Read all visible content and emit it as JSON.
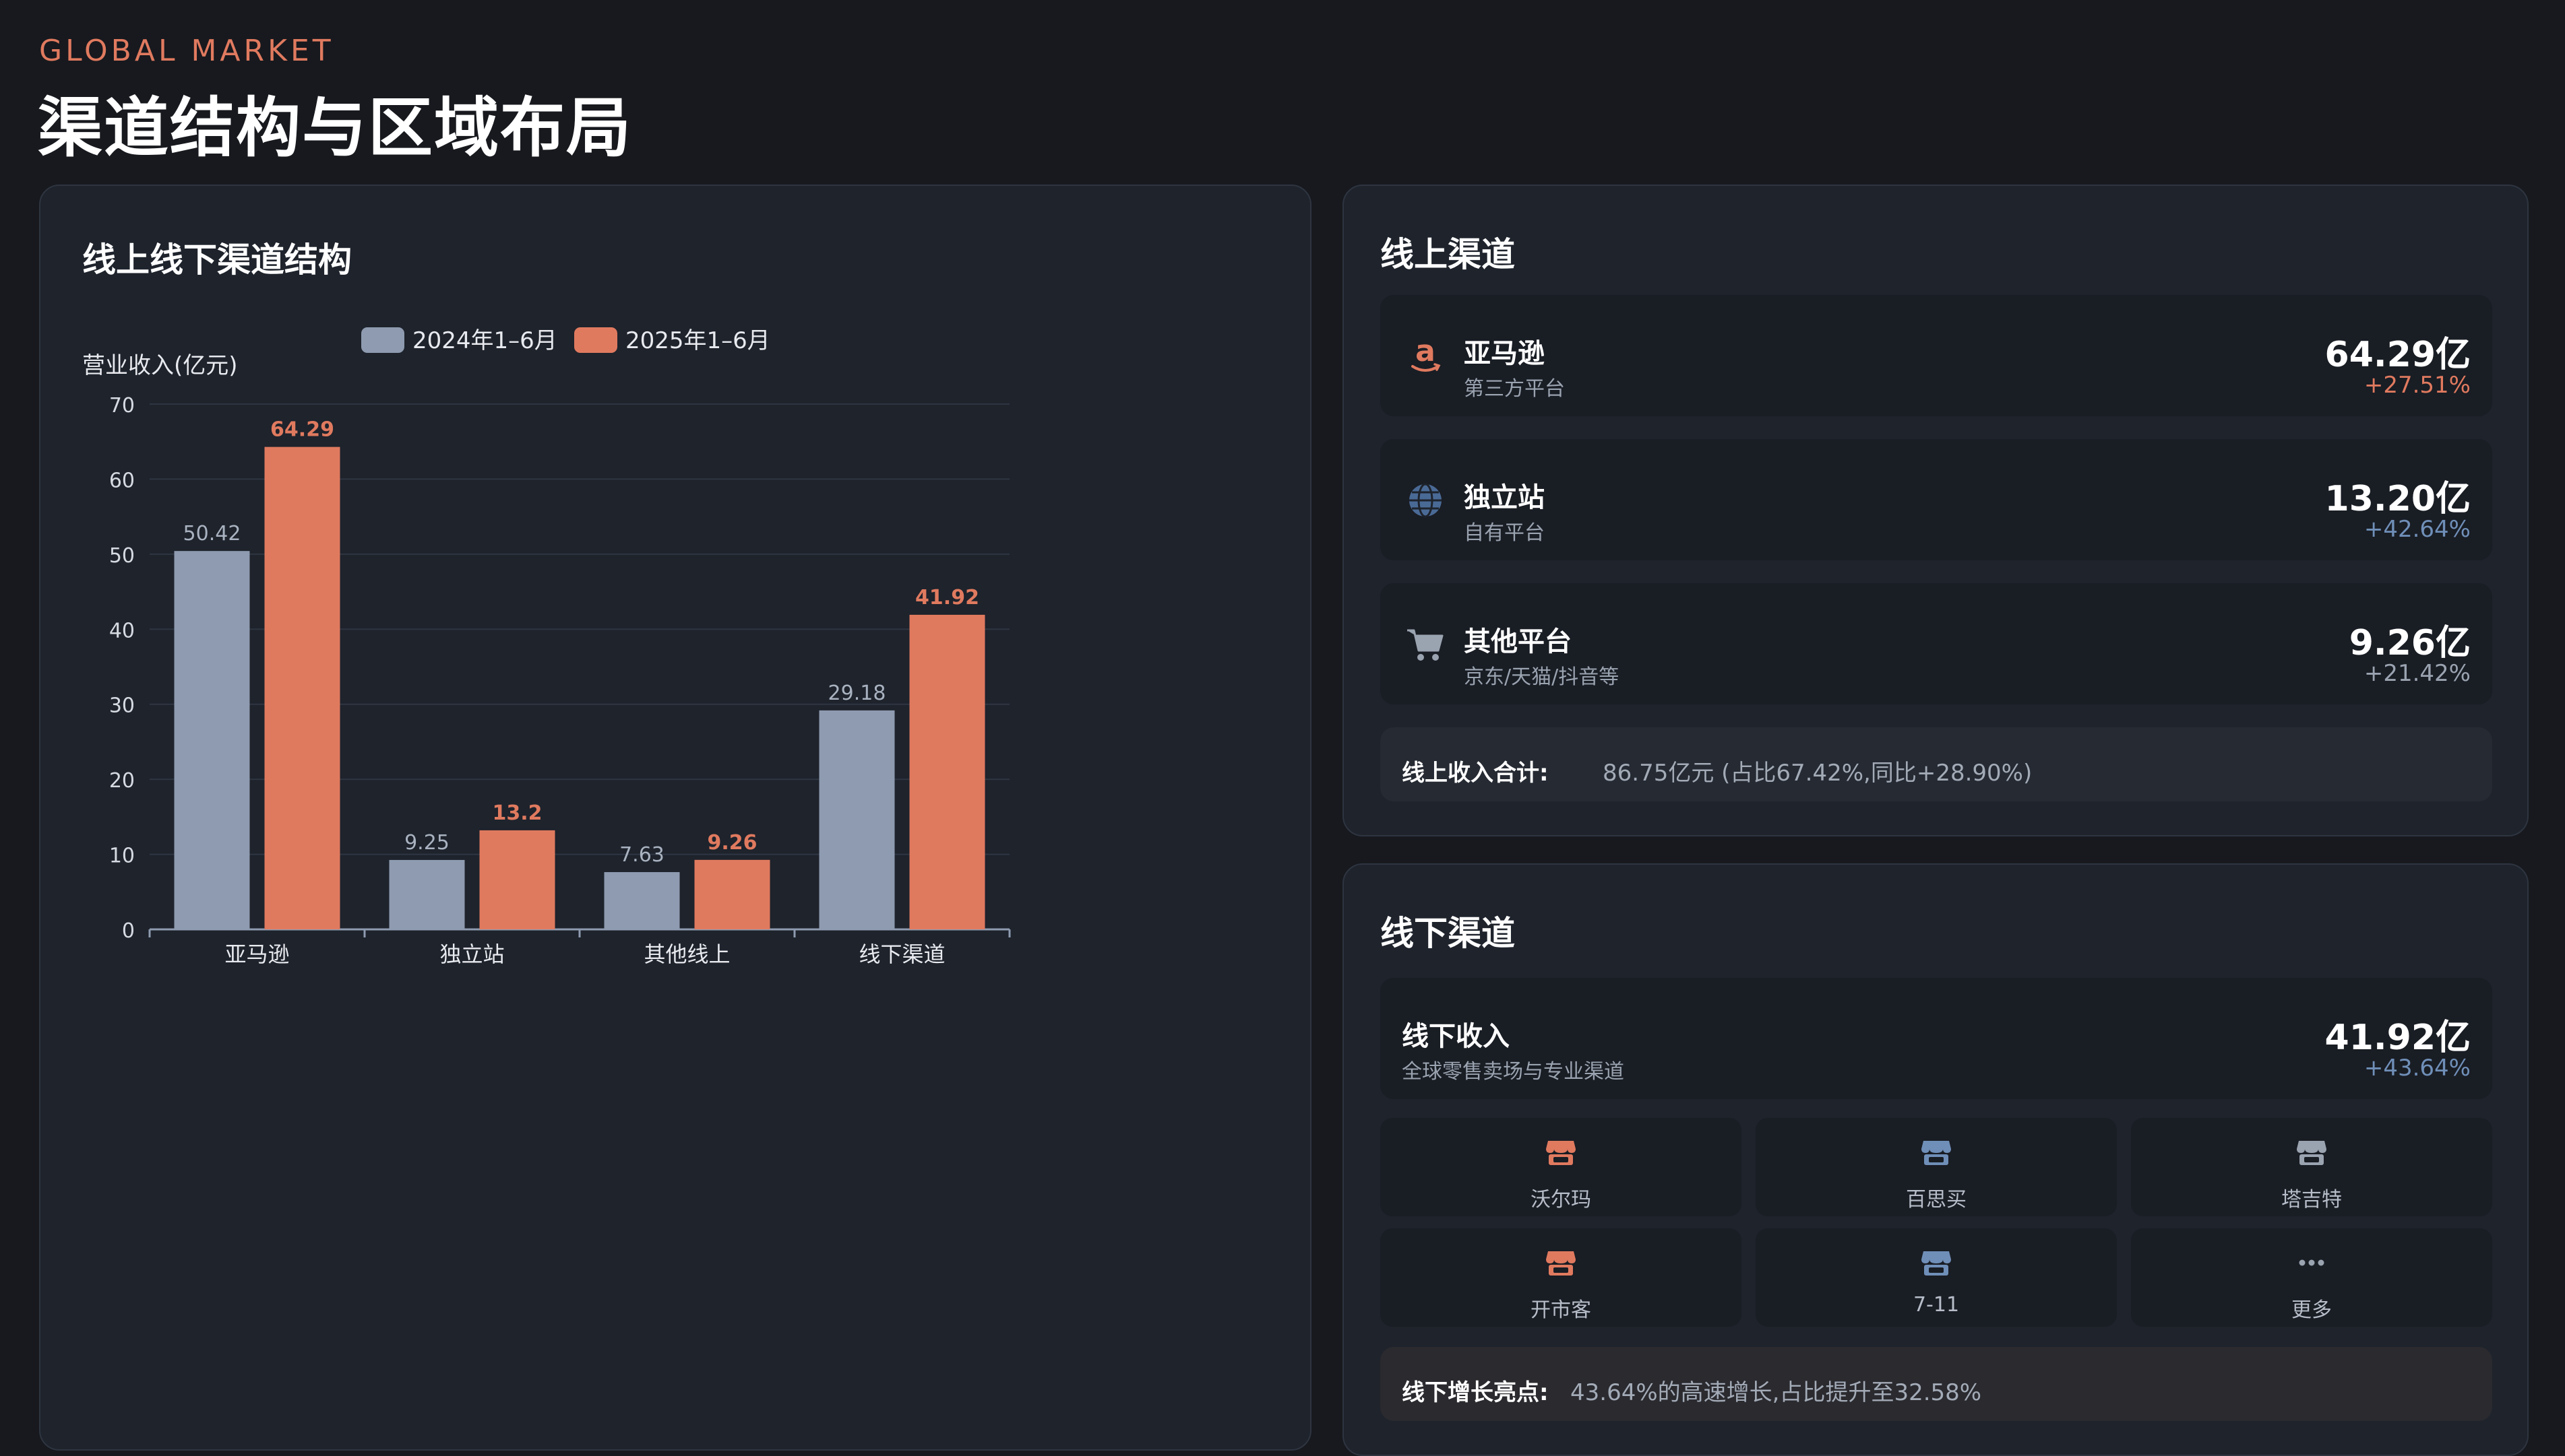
{
  "header": {
    "eyebrow": "GLOBAL MARKET",
    "title": "渠道结构与区域布局"
  },
  "chart_card": {
    "title": "线上线下渠道结构"
  },
  "chart_data": {
    "type": "bar",
    "categories": [
      "亚马逊",
      "独立站",
      "其他线上",
      "线下渠道"
    ],
    "series": [
      {
        "name": "2024年1–6月",
        "values": [
          50.42,
          9.25,
          7.63,
          29.18
        ],
        "color": "#8e9bb0"
      },
      {
        "name": "2025年1–6月",
        "values": [
          64.29,
          13.2,
          9.26,
          41.92
        ],
        "color": "#e07a5f"
      }
    ],
    "title": "",
    "xlabel": "",
    "ylabel": "营业收入(亿元)",
    "ylim": [
      0,
      70
    ],
    "yticks": [
      0,
      10,
      20,
      30,
      40,
      50,
      60,
      70
    ],
    "grid": true,
    "legend": "top"
  },
  "online": {
    "title": "线上渠道",
    "items": [
      {
        "name": "亚马逊",
        "sub": "第三方平台",
        "value": "64.29亿",
        "change": "+27.51%",
        "icon": "amazon-icon",
        "change_color": "#e07a5f"
      },
      {
        "name": "独立站",
        "sub": "自有平台",
        "value": "13.20亿",
        "change": "+42.64%",
        "icon": "globe-icon",
        "change_color": "#6f8fb8"
      },
      {
        "name": "其他平台",
        "sub": "京东/天猫/抖音等",
        "value": "9.26亿",
        "change": "+21.42%",
        "icon": "cart-icon",
        "change_color": "#9aa3b0"
      }
    ],
    "summary_label": "线上收入合计:",
    "summary_value": "86.75亿元 (占比67.42%,同比+28.90%)"
  },
  "offline": {
    "title": "线下渠道",
    "main": {
      "name": "线下收入",
      "sub": "全球零售卖场与专业渠道",
      "value": "41.92亿",
      "change": "+43.64%",
      "change_color": "#6f8fb8"
    },
    "stores": [
      {
        "label": "沃尔玛",
        "icon": "store-icon",
        "color": "#e07a5f"
      },
      {
        "label": "百思买",
        "icon": "store-icon",
        "color": "#6f8fb8"
      },
      {
        "label": "塔吉特",
        "icon": "store-icon",
        "color": "#9aa3b0"
      },
      {
        "label": "开市客",
        "icon": "store-icon",
        "color": "#e07a5f"
      },
      {
        "label": "7-11",
        "icon": "store-icon",
        "color": "#6f8fb8"
      },
      {
        "label": "更多",
        "icon": "more-dots-icon",
        "color": "#9aa3b0"
      }
    ],
    "highlight_label": "线下增长亮点:",
    "highlight_value": "43.64%的高速增长,占比提升至32.58%"
  }
}
